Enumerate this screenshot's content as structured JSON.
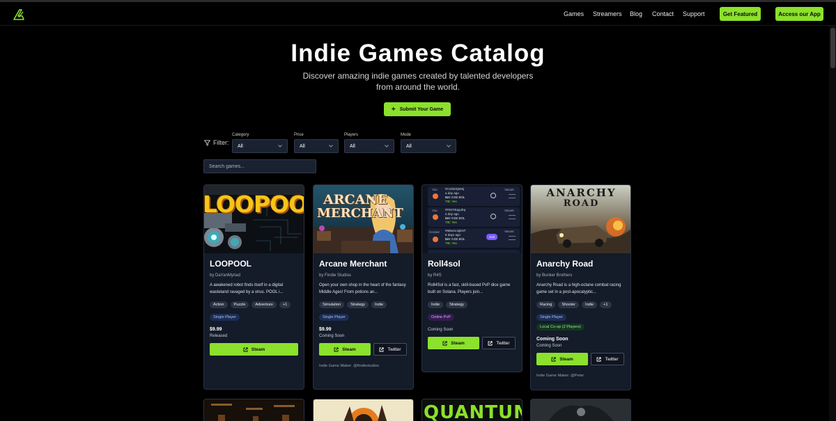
{
  "nav": {
    "links": [
      "Games",
      "Streamers",
      "Blog",
      "Contact",
      "Support"
    ],
    "get_featured": "Get Featured",
    "access_app": "Access our App"
  },
  "hero": {
    "title": "Indie Games Catalog",
    "subtitle": "Discover amazing indie games created by talented developers from around the world.",
    "submit_label": "Submit Your Game"
  },
  "filters": {
    "label": "Filter:",
    "groups": [
      {
        "label": "Category",
        "value": "All"
      },
      {
        "label": "Price",
        "value": "All"
      },
      {
        "label": "Players",
        "value": "All"
      },
      {
        "label": "Mode",
        "value": "All"
      }
    ],
    "search_placeholder": "Search games..."
  },
  "games": [
    {
      "title": "LOOPOOL",
      "by": "by DaYanMyriad",
      "description": "A awakened robot finds itself in a digital wasteland ravaged by a virus. POOL i...",
      "tags": [
        "Action",
        "Puzzle",
        "Adventure",
        "+1"
      ],
      "modes": [
        "Single Player"
      ],
      "price": "$9.99",
      "status": "Released",
      "steam": "Steam"
    },
    {
      "title": "Arcane Merchant",
      "by": "by Findie Studios",
      "description": "Open your own shop in the heart of the fantasy Middle Ages! From potions an...",
      "tags": [
        "Simulation",
        "Strategy",
        "Indie"
      ],
      "modes": [
        "Single Player"
      ],
      "price": "$9.99",
      "status": "Coming Soon",
      "steam": "Steam",
      "twitter": "Twitter",
      "maker": "Indie Game Maker: @findiestudios"
    },
    {
      "title": "Roll4sol",
      "by": "by R4S",
      "description": "Roll4Sol is a fast, skill-based PvP dice game built on Solana. Players join...",
      "tags": [
        "Indie",
        "Strategy"
      ],
      "modes": [
        "Online PvP"
      ],
      "status": "Coming Soon",
      "steam": "Steam",
      "twitter": "Twitter"
    },
    {
      "title": "Anarchy Road",
      "by": "by Bunker Brothers",
      "description": "Anarchy Road is a high-octane combat racing game set in a post-apocalyptic...",
      "tags": [
        "Racing",
        "Shooter",
        "Indie",
        "+1"
      ],
      "modes": [
        "Single Player",
        "Local Co-op (2 Players)"
      ],
      "price": "Coming Soon",
      "status": "Coming Soon",
      "steam": "Steam",
      "twitter": "Twitter",
      "maker": "Indie Game Maker: @Peter"
    }
  ],
  "thumb_text": {
    "loopool": "LOOPOOL",
    "arcane_line1": "ARCANE",
    "arcane_line2": "MERCHANT",
    "anarchy_line1": "ANARCHY",
    "anarchy_line2": "ROAD",
    "quantum": "QUANTUM",
    "roll_rows": [
      {
        "player": "You",
        "id": "#Cmb0Xj846j",
        "time": "a day ago",
        "bet": "Bet: 0.02 SOL",
        "tie": "TIE: Yes",
        "right": "Vacant"
      },
      {
        "player": "You",
        "id": "#FE6TEqqJEq",
        "time": "a day ago",
        "bet": "Bet: 0.02 SOL",
        "tie": "TIE: Yes",
        "right": "Vacant"
      },
      {
        "player": "Creator",
        "id": "#6Bw4L3gkNT",
        "time": "6 days ago",
        "bet": "Bet: 0.02 SOL",
        "tie": "TIE: Yes",
        "right": "Vacant",
        "join": "Join"
      }
    ]
  },
  "colors": {
    "accent": "#8be12b",
    "card_bg": "#141b29",
    "page_bg": "#000000"
  }
}
